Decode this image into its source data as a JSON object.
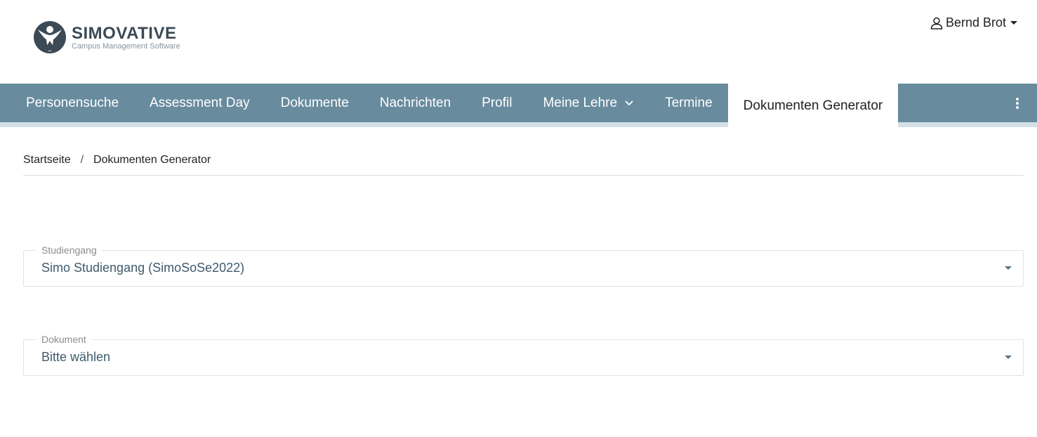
{
  "logo": {
    "name": "SIMOVATIVE",
    "tagline": "Campus Management Software"
  },
  "user": {
    "name": "Bernd Brot",
    "icon": "user-icon"
  },
  "nav": {
    "items": [
      {
        "label": "Personensuche"
      },
      {
        "label": "Assessment Day"
      },
      {
        "label": "Dokumente"
      },
      {
        "label": "Nachrichten"
      },
      {
        "label": "Profil"
      },
      {
        "label": "Meine Lehre",
        "has_dropdown": true
      },
      {
        "label": "Termine"
      },
      {
        "label": "Dokumenten Generator",
        "active": true
      }
    ],
    "more_icon": "kebab-menu-icon"
  },
  "breadcrumb": {
    "home": "Startseite",
    "separator": "/",
    "current": "Dokumenten Generator"
  },
  "form": {
    "studiengang": {
      "label": "Studiengang",
      "value": "Simo Studiengang (SimoSoSe2022)"
    },
    "dokument": {
      "label": "Dokument",
      "value": "Bitte wählen"
    }
  },
  "colors": {
    "nav_bg": "#688b9e",
    "nav_strip": "#d4e1e7",
    "logo_dark": "#3c4a56",
    "field_text": "#3e5a6b"
  }
}
